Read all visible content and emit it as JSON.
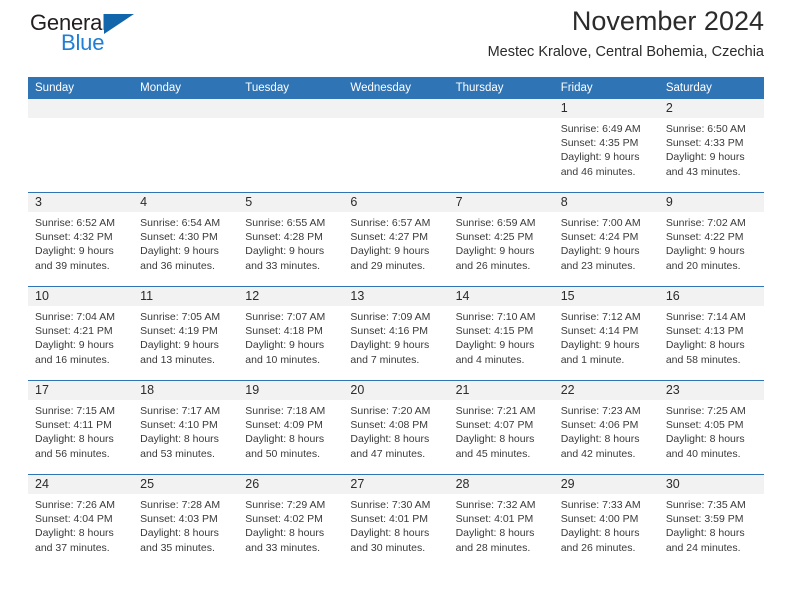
{
  "brand": {
    "name_part1": "General",
    "name_part2": "Blue",
    "triangle_color": "#1166ab",
    "blue_color": "#1f7fd4"
  },
  "header": {
    "title": "November 2024",
    "subtitle": "Mestec Kralove, Central Bohemia, Czechia"
  },
  "theme": {
    "header_blue": "#2f74b5",
    "daynum_band": "#f2f2f2",
    "text": "#2b2b2b"
  },
  "weekdays": [
    "Sunday",
    "Monday",
    "Tuesday",
    "Wednesday",
    "Thursday",
    "Friday",
    "Saturday"
  ],
  "weeks": [
    [
      {
        "day": "",
        "sunrise": "",
        "sunset": "",
        "daylight1": "",
        "daylight2": "",
        "empty": true
      },
      {
        "day": "",
        "sunrise": "",
        "sunset": "",
        "daylight1": "",
        "daylight2": "",
        "empty": true
      },
      {
        "day": "",
        "sunrise": "",
        "sunset": "",
        "daylight1": "",
        "daylight2": "",
        "empty": true
      },
      {
        "day": "",
        "sunrise": "",
        "sunset": "",
        "daylight1": "",
        "daylight2": "",
        "empty": true
      },
      {
        "day": "",
        "sunrise": "",
        "sunset": "",
        "daylight1": "",
        "daylight2": "",
        "empty": true
      },
      {
        "day": "1",
        "sunrise": "Sunrise: 6:49 AM",
        "sunset": "Sunset: 4:35 PM",
        "daylight1": "Daylight: 9 hours",
        "daylight2": "and 46 minutes."
      },
      {
        "day": "2",
        "sunrise": "Sunrise: 6:50 AM",
        "sunset": "Sunset: 4:33 PM",
        "daylight1": "Daylight: 9 hours",
        "daylight2": "and 43 minutes."
      }
    ],
    [
      {
        "day": "3",
        "sunrise": "Sunrise: 6:52 AM",
        "sunset": "Sunset: 4:32 PM",
        "daylight1": "Daylight: 9 hours",
        "daylight2": "and 39 minutes."
      },
      {
        "day": "4",
        "sunrise": "Sunrise: 6:54 AM",
        "sunset": "Sunset: 4:30 PM",
        "daylight1": "Daylight: 9 hours",
        "daylight2": "and 36 minutes."
      },
      {
        "day": "5",
        "sunrise": "Sunrise: 6:55 AM",
        "sunset": "Sunset: 4:28 PM",
        "daylight1": "Daylight: 9 hours",
        "daylight2": "and 33 minutes."
      },
      {
        "day": "6",
        "sunrise": "Sunrise: 6:57 AM",
        "sunset": "Sunset: 4:27 PM",
        "daylight1": "Daylight: 9 hours",
        "daylight2": "and 29 minutes."
      },
      {
        "day": "7",
        "sunrise": "Sunrise: 6:59 AM",
        "sunset": "Sunset: 4:25 PM",
        "daylight1": "Daylight: 9 hours",
        "daylight2": "and 26 minutes."
      },
      {
        "day": "8",
        "sunrise": "Sunrise: 7:00 AM",
        "sunset": "Sunset: 4:24 PM",
        "daylight1": "Daylight: 9 hours",
        "daylight2": "and 23 minutes."
      },
      {
        "day": "9",
        "sunrise": "Sunrise: 7:02 AM",
        "sunset": "Sunset: 4:22 PM",
        "daylight1": "Daylight: 9 hours",
        "daylight2": "and 20 minutes."
      }
    ],
    [
      {
        "day": "10",
        "sunrise": "Sunrise: 7:04 AM",
        "sunset": "Sunset: 4:21 PM",
        "daylight1": "Daylight: 9 hours",
        "daylight2": "and 16 minutes."
      },
      {
        "day": "11",
        "sunrise": "Sunrise: 7:05 AM",
        "sunset": "Sunset: 4:19 PM",
        "daylight1": "Daylight: 9 hours",
        "daylight2": "and 13 minutes."
      },
      {
        "day": "12",
        "sunrise": "Sunrise: 7:07 AM",
        "sunset": "Sunset: 4:18 PM",
        "daylight1": "Daylight: 9 hours",
        "daylight2": "and 10 minutes."
      },
      {
        "day": "13",
        "sunrise": "Sunrise: 7:09 AM",
        "sunset": "Sunset: 4:16 PM",
        "daylight1": "Daylight: 9 hours",
        "daylight2": "and 7 minutes."
      },
      {
        "day": "14",
        "sunrise": "Sunrise: 7:10 AM",
        "sunset": "Sunset: 4:15 PM",
        "daylight1": "Daylight: 9 hours",
        "daylight2": "and 4 minutes."
      },
      {
        "day": "15",
        "sunrise": "Sunrise: 7:12 AM",
        "sunset": "Sunset: 4:14 PM",
        "daylight1": "Daylight: 9 hours",
        "daylight2": "and 1 minute."
      },
      {
        "day": "16",
        "sunrise": "Sunrise: 7:14 AM",
        "sunset": "Sunset: 4:13 PM",
        "daylight1": "Daylight: 8 hours",
        "daylight2": "and 58 minutes."
      }
    ],
    [
      {
        "day": "17",
        "sunrise": "Sunrise: 7:15 AM",
        "sunset": "Sunset: 4:11 PM",
        "daylight1": "Daylight: 8 hours",
        "daylight2": "and 56 minutes."
      },
      {
        "day": "18",
        "sunrise": "Sunrise: 7:17 AM",
        "sunset": "Sunset: 4:10 PM",
        "daylight1": "Daylight: 8 hours",
        "daylight2": "and 53 minutes."
      },
      {
        "day": "19",
        "sunrise": "Sunrise: 7:18 AM",
        "sunset": "Sunset: 4:09 PM",
        "daylight1": "Daylight: 8 hours",
        "daylight2": "and 50 minutes."
      },
      {
        "day": "20",
        "sunrise": "Sunrise: 7:20 AM",
        "sunset": "Sunset: 4:08 PM",
        "daylight1": "Daylight: 8 hours",
        "daylight2": "and 47 minutes."
      },
      {
        "day": "21",
        "sunrise": "Sunrise: 7:21 AM",
        "sunset": "Sunset: 4:07 PM",
        "daylight1": "Daylight: 8 hours",
        "daylight2": "and 45 minutes."
      },
      {
        "day": "22",
        "sunrise": "Sunrise: 7:23 AM",
        "sunset": "Sunset: 4:06 PM",
        "daylight1": "Daylight: 8 hours",
        "daylight2": "and 42 minutes."
      },
      {
        "day": "23",
        "sunrise": "Sunrise: 7:25 AM",
        "sunset": "Sunset: 4:05 PM",
        "daylight1": "Daylight: 8 hours",
        "daylight2": "and 40 minutes."
      }
    ],
    [
      {
        "day": "24",
        "sunrise": "Sunrise: 7:26 AM",
        "sunset": "Sunset: 4:04 PM",
        "daylight1": "Daylight: 8 hours",
        "daylight2": "and 37 minutes."
      },
      {
        "day": "25",
        "sunrise": "Sunrise: 7:28 AM",
        "sunset": "Sunset: 4:03 PM",
        "daylight1": "Daylight: 8 hours",
        "daylight2": "and 35 minutes."
      },
      {
        "day": "26",
        "sunrise": "Sunrise: 7:29 AM",
        "sunset": "Sunset: 4:02 PM",
        "daylight1": "Daylight: 8 hours",
        "daylight2": "and 33 minutes."
      },
      {
        "day": "27",
        "sunrise": "Sunrise: 7:30 AM",
        "sunset": "Sunset: 4:01 PM",
        "daylight1": "Daylight: 8 hours",
        "daylight2": "and 30 minutes."
      },
      {
        "day": "28",
        "sunrise": "Sunrise: 7:32 AM",
        "sunset": "Sunset: 4:01 PM",
        "daylight1": "Daylight: 8 hours",
        "daylight2": "and 28 minutes."
      },
      {
        "day": "29",
        "sunrise": "Sunrise: 7:33 AM",
        "sunset": "Sunset: 4:00 PM",
        "daylight1": "Daylight: 8 hours",
        "daylight2": "and 26 minutes."
      },
      {
        "day": "30",
        "sunrise": "Sunrise: 7:35 AM",
        "sunset": "Sunset: 3:59 PM",
        "daylight1": "Daylight: 8 hours",
        "daylight2": "and 24 minutes."
      }
    ]
  ]
}
